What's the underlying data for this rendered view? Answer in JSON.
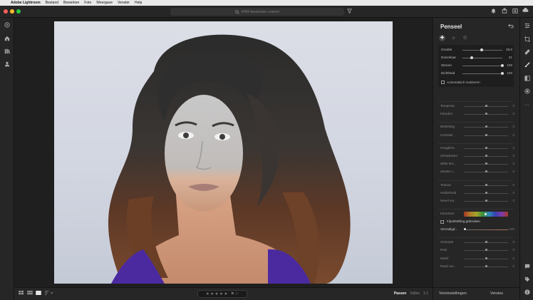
{
  "menubar": {
    "items": [
      "Adobe Lightroom",
      "Bestand",
      "Bewerken",
      "Foto",
      "Weergave",
      "Venster",
      "Help"
    ]
  },
  "search": {
    "placeholder": "RAW-bestanden zoeken"
  },
  "panel": {
    "title": "Penseel",
    "brush": {
      "sliders": [
        {
          "label": "Grootte",
          "value": "39,9",
          "level": 0.46
        },
        {
          "label": "Doezelaar",
          "value": "21",
          "level": 0.2
        },
        {
          "label": "Stroom",
          "value": "100",
          "level": 1.0
        },
        {
          "label": "Dichtheid",
          "value": "100",
          "level": 1.0
        }
      ],
      "automask_label": "Automatisch maskeren"
    },
    "adjust_groups": [
      [
        {
          "label": "Temperat...",
          "value": "0",
          "level": 0.5
        },
        {
          "label": "Kleurtint",
          "value": "0",
          "level": 0.5
        }
      ],
      [
        {
          "label": "Belichting",
          "value": "0",
          "level": 0.5
        },
        {
          "label": "Contrast",
          "value": "0",
          "level": 0.5
        }
      ],
      [
        {
          "label": "Hooglicht...",
          "value": "0",
          "level": 0.5
        },
        {
          "label": "Schaduwen",
          "value": "0",
          "level": 0.5
        },
        {
          "label": "Witte tint...",
          "value": "0",
          "level": 0.5
        },
        {
          "label": "Zwarte t...",
          "value": "0",
          "level": 0.5
        }
      ],
      [
        {
          "label": "Textuur",
          "value": "0",
          "level": 0.5
        },
        {
          "label": "Helderheid",
          "value": "0",
          "level": 0.5
        },
        {
          "label": "Nevel ver...",
          "value": "0",
          "level": 0.5
        }
      ]
    ],
    "color": {
      "hue_label": "Kleurtoon",
      "hue_value": "",
      "fine_label": "Fijnafstelling gebruiken",
      "saturation_label": "Verzadigd...",
      "saturation_value": "-100",
      "saturation_level": 0.0
    },
    "detail_group": [
      {
        "label": "Scherpte",
        "value": "0",
        "level": 0.5
      },
      {
        "label": "Ruis",
        "value": "0",
        "level": 0.5
      },
      {
        "label": "Moiré",
        "value": "0",
        "level": 0.5
      },
      {
        "label": "Rand ver...",
        "value": "0",
        "level": 0.5
      }
    ]
  },
  "bottombar": {
    "fit_label": "Passen",
    "fill_label": "Vullen",
    "ratio_label": "1:1"
  },
  "panel_bottom": {
    "presets_label": "Voorinstellingen",
    "versions_label": "Versies"
  },
  "colors": {
    "traffic_red": "#fe5f57",
    "traffic_yellow": "#febc2e",
    "traffic_green": "#28c840"
  }
}
